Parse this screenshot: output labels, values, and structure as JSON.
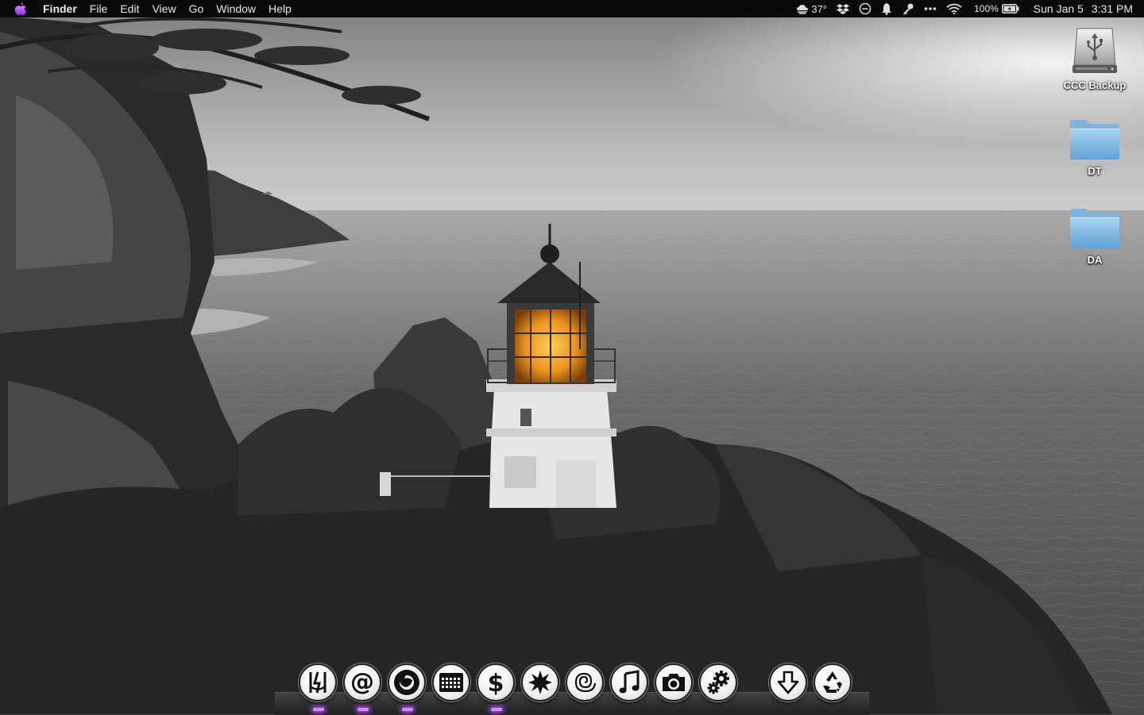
{
  "menubar": {
    "app_name": "Finder",
    "menus": [
      "File",
      "Edit",
      "View",
      "Go",
      "Window",
      "Help"
    ],
    "status": {
      "weather_temp": "37°",
      "battery_percent": "100%",
      "date": "Sun Jan 5",
      "time": "3:31 PM"
    }
  },
  "desktop": {
    "icons": [
      {
        "label": "CCC Backup",
        "icon": "usb-drive-icon"
      },
      {
        "label": "DT",
        "icon": "folder-icon"
      },
      {
        "label": "DA",
        "icon": "folder-icon"
      }
    ]
  },
  "dock": {
    "items": [
      {
        "icon": "finder-icon",
        "running": true
      },
      {
        "icon": "mail-icon",
        "running": true
      },
      {
        "icon": "firefox-icon",
        "running": true
      },
      {
        "icon": "calendar-icon",
        "running": false
      },
      {
        "icon": "dollar-icon",
        "running": true
      },
      {
        "icon": "star-burst-icon",
        "running": false
      },
      {
        "icon": "spiral-icon",
        "running": false
      },
      {
        "icon": "music-note-icon",
        "running": false
      },
      {
        "icon": "camera-icon",
        "running": false
      },
      {
        "icon": "gears-icon",
        "running": false
      },
      {
        "icon": "downloads-icon",
        "running": false
      },
      {
        "icon": "trash-recycle-icon",
        "running": false
      }
    ]
  },
  "colors": {
    "menubar_bg": "#0a0a0a",
    "lighthouse_lamp": "#e8921c",
    "running_indicator": "#d98cff"
  }
}
